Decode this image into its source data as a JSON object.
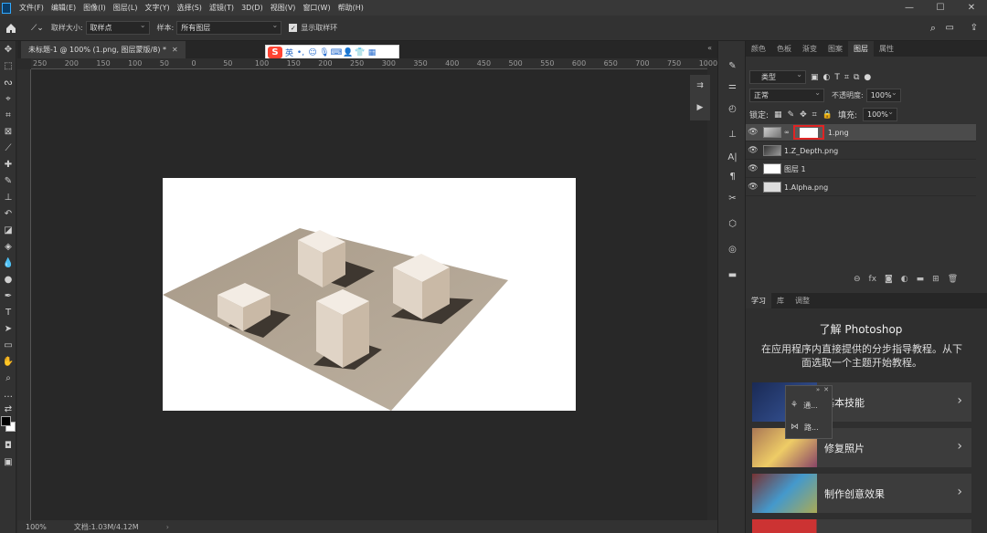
{
  "menu": [
    "文件(F)",
    "编辑(E)",
    "图像(I)",
    "图层(L)",
    "文字(Y)",
    "选择(S)",
    "滤镜(T)",
    "3D(D)",
    "视图(V)",
    "窗口(W)",
    "帮助(H)"
  ],
  "window_controls": [
    "—",
    "☐",
    "✕"
  ],
  "options": {
    "sample_size_label": "取样大小:",
    "sample_size_value": "取样点",
    "sample_label": "样本:",
    "sample_value": "所有图层",
    "show_ring_label": "显示取样环"
  },
  "document_tab": "未标题-1 @ 100% (1.png, 图层蒙版/8) *",
  "ime": {
    "logo": "S",
    "lang": "英"
  },
  "ruler_labels": [
    "250",
    "200",
    "150",
    "100",
    "50",
    "0",
    "50",
    "100",
    "150",
    "200",
    "250",
    "300",
    "350",
    "400",
    "450",
    "500",
    "550",
    "600",
    "650",
    "700",
    "750",
    "1000"
  ],
  "status": {
    "zoom": "100%",
    "doc": "文档:1.03M/4.12M"
  },
  "panel_tabs": [
    "颜色",
    "色板",
    "渐变",
    "图案",
    "图层",
    "属性"
  ],
  "layers_panel": {
    "filter_kind": "类型",
    "blend_mode": "正常",
    "opacity_label": "不透明度:",
    "opacity_value": "100%",
    "lock_label": "锁定:",
    "fill_label": "填充:",
    "fill_value": "100%",
    "layers": [
      {
        "name": "1.png",
        "selected": true
      },
      {
        "name": "1.Z_Depth.png",
        "selected": false
      },
      {
        "name": "图层 1",
        "selected": false
      },
      {
        "name": "1.Alpha.png",
        "selected": false
      }
    ]
  },
  "learn_tabs": [
    "学习",
    "库",
    "调整"
  ],
  "learn": {
    "title": "了解 Photoshop",
    "desc": "在应用程序内直接提供的分步指导教程。从下面选取一个主题开始教程。",
    "cards": [
      "基本技能",
      "修复照片",
      "制作创意效果"
    ]
  },
  "float_panel": [
    "通...",
    "路..."
  ],
  "accent": "#e02424"
}
